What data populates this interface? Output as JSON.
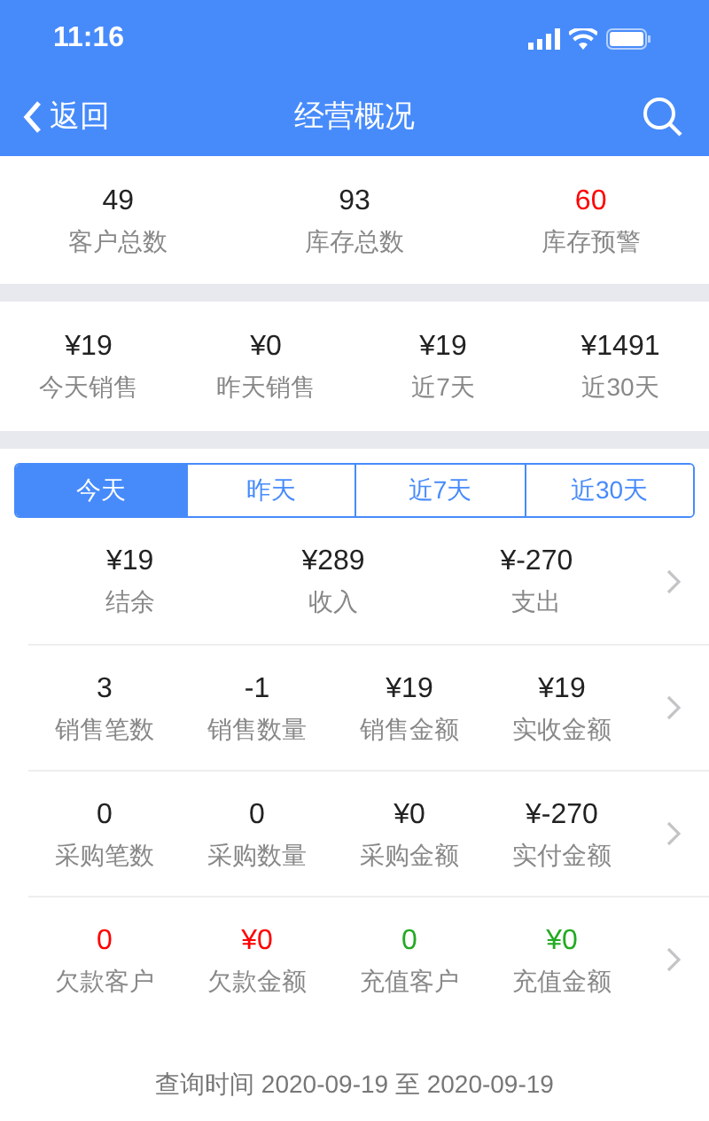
{
  "status_bar": {
    "time": "11:16"
  },
  "nav": {
    "back": "返回",
    "title": "经营概况"
  },
  "summary": [
    {
      "value": "49",
      "label": "客户总数",
      "color": "#222222"
    },
    {
      "value": "93",
      "label": "库存总数",
      "color": "#222222"
    },
    {
      "value": "60",
      "label": "库存预警",
      "color": "#ff0000"
    }
  ],
  "sales": [
    {
      "value": "¥19",
      "label": "今天销售"
    },
    {
      "value": "¥0",
      "label": "昨天销售"
    },
    {
      "value": "¥19",
      "label": "近7天"
    },
    {
      "value": "¥1491",
      "label": "近30天"
    }
  ],
  "tabs": [
    {
      "label": "今天",
      "selected": true
    },
    {
      "label": "昨天",
      "selected": false
    },
    {
      "label": "近7天",
      "selected": false
    },
    {
      "label": "近30天",
      "selected": false
    }
  ],
  "detail_rows": [
    {
      "items": [
        {
          "value": "¥19",
          "label": "结余",
          "color": "#222222"
        },
        {
          "value": "¥289",
          "label": "收入",
          "color": "#222222"
        },
        {
          "value": "¥-270",
          "label": "支出",
          "color": "#222222"
        }
      ]
    },
    {
      "items": [
        {
          "value": "3",
          "label": "销售笔数",
          "color": "#222222"
        },
        {
          "value": "-1",
          "label": "销售数量",
          "color": "#222222"
        },
        {
          "value": "¥19",
          "label": "销售金额",
          "color": "#222222"
        },
        {
          "value": "¥19",
          "label": "实收金额",
          "color": "#222222"
        }
      ]
    },
    {
      "items": [
        {
          "value": "0",
          "label": "采购笔数",
          "color": "#222222"
        },
        {
          "value": "0",
          "label": "采购数量",
          "color": "#222222"
        },
        {
          "value": "¥0",
          "label": "采购金额",
          "color": "#222222"
        },
        {
          "value": "¥-270",
          "label": "实付金额",
          "color": "#222222"
        }
      ]
    },
    {
      "items": [
        {
          "value": "0",
          "label": "欠款客户",
          "color": "#ff0000"
        },
        {
          "value": "¥0",
          "label": "欠款金额",
          "color": "#ff0000"
        },
        {
          "value": "0",
          "label": "充值客户",
          "color": "#22aa22"
        },
        {
          "value": "¥0",
          "label": "充值金额",
          "color": "#22aa22"
        }
      ]
    }
  ],
  "footer": "查询时间 2020-09-19 至 2020-09-19"
}
